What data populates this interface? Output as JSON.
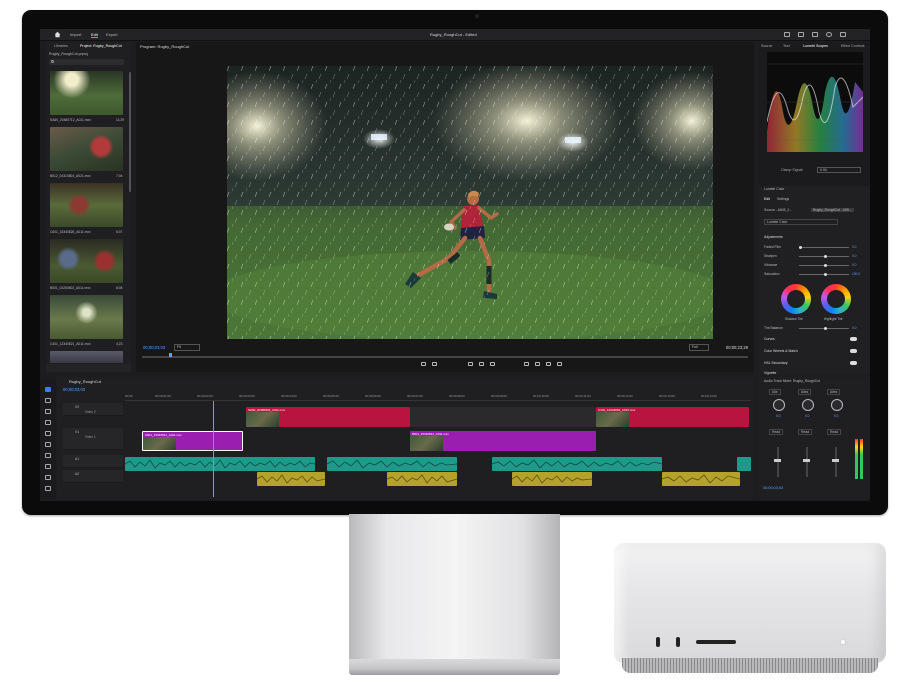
{
  "app": {
    "window_title": "Rugby_RoughCut - Edited",
    "nav": [
      "Import",
      "Edit",
      "Export"
    ],
    "active_nav": "Edit"
  },
  "project": {
    "tabs": [
      "Libraries",
      "Project: Rugby_RoughCut"
    ],
    "path": "Rugby_RoughCut.prproj",
    "clips": [
      {
        "name": "SA60_20480712_A011.mxx",
        "duration": "11;29"
      },
      {
        "name": "B612_04310804_A021.mxx",
        "duration": "7;04"
      },
      {
        "name": "C601_15340826_A011.mxx",
        "duration": "6;07"
      },
      {
        "name": "B601_04250602_A011.mxx",
        "duration": "8;08"
      },
      {
        "name": "C401_12340821_A011.mxx",
        "duration": "4;23"
      }
    ]
  },
  "program": {
    "title": "Program: Rugby_RoughCut",
    "timecode": "00;00;03;03",
    "fit": "Fit",
    "quality": "Full",
    "duration": "00;00;23;29"
  },
  "scopes": {
    "tabs": [
      "Source",
      "Text",
      "Lumetri Scopes",
      "Effect Controls"
    ],
    "clamp_label": "Clamp Signal",
    "bit_depth": "8 Bit"
  },
  "lumetri": {
    "title": "Lumetri Color",
    "tabs": [
      "Edit",
      "Settings"
    ],
    "source_label": "Source - A605_2...",
    "seq_label": "Rugby_RoughCut - A05...",
    "preset": "Lumetri Color",
    "adjustments_label": "Adjustments",
    "sliders": [
      {
        "label": "Faded Film",
        "value": "0.0"
      },
      {
        "label": "Sharpen",
        "value": "0.0"
      },
      {
        "label": "Vibrance",
        "value": "0.0"
      },
      {
        "label": "Saturation",
        "value": "100.0"
      }
    ],
    "wheels": [
      "Shadow Tint",
      "Highlight Tint"
    ],
    "tint_balance": {
      "label": "Tint Balance",
      "value": "0.0"
    },
    "sections": [
      "Curves",
      "Color Wheels & Match",
      "HSL Secondary",
      "Vignette"
    ]
  },
  "timeline": {
    "sequence": "Rugby_RoughCut",
    "timecode": "00;00;03;03",
    "ticks": [
      "00;00",
      "00;00;01;00",
      "00;00;02;00",
      "00;00;03;00",
      "00;00;04;00",
      "00;00;05;00",
      "00;00;06;00",
      "00;00;07;00",
      "00;00;08;00",
      "00;00;09;00",
      "00;00;10;00",
      "00;00;11;00",
      "00;00;12;00",
      "00;00;13;00",
      "00;00;14;00"
    ],
    "tracks": [
      {
        "id": "V2",
        "name": "Video 2"
      },
      {
        "id": "V1",
        "name": "Video 1"
      },
      {
        "id": "A1",
        "name": ""
      },
      {
        "id": "A2",
        "name": ""
      }
    ],
    "video_clips": [
      {
        "name": "SA60_20480826_A011.mxx",
        "color": "#b8143f"
      },
      {
        "name": "C401_12342804_A015.mxx",
        "color": "#b8143f"
      },
      {
        "name": "A601_15340812_A011.mxx",
        "color": "#9a1fb0"
      },
      {
        "name": "B601_15340812_A011.mxx",
        "color": "#9a1fb0"
      }
    ],
    "audio_colors": {
      "a1": "#1e9a8a",
      "a2": "#b5a22a"
    }
  },
  "mixer": {
    "title": "Audio Track Mixer: Rugby_RoughCut",
    "routes": [
      "Alle",
      "Alles",
      "Alles"
    ],
    "dial_values": [
      "0.0",
      "0.0",
      "0.0"
    ],
    "reads": [
      "Read",
      "Read",
      "Read"
    ],
    "timecode": "00;00;03;03"
  }
}
